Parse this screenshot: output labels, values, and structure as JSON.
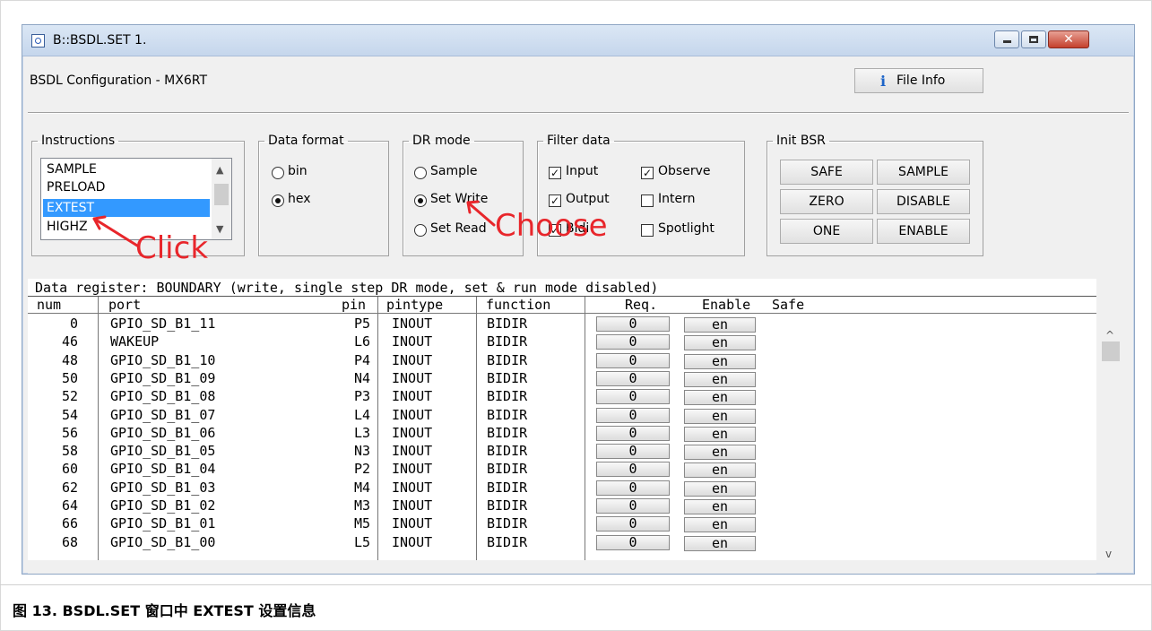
{
  "window": {
    "title": "B::BSDL.SET 1."
  },
  "config": {
    "label": "BSDL Configuration -  MX6RT",
    "file_info_label": "File Info"
  },
  "instructions": {
    "legend": "Instructions",
    "items": [
      "SAMPLE",
      "PRELOAD",
      "EXTEST",
      "HIGHZ"
    ],
    "selected": "EXTEST"
  },
  "data_format": {
    "legend": "Data format",
    "options": [
      "bin",
      "hex"
    ],
    "selected": "hex"
  },
  "dr_mode": {
    "legend": "DR mode",
    "options": [
      "Sample",
      "Set Write",
      "Set Read"
    ],
    "selected": "Set Write"
  },
  "filter_data": {
    "legend": "Filter data",
    "checks": [
      {
        "label": "Input",
        "checked": true
      },
      {
        "label": "Observe",
        "checked": true
      },
      {
        "label": "Output",
        "checked": true
      },
      {
        "label": "Intern",
        "checked": false
      },
      {
        "label": "Bidi",
        "checked": true
      },
      {
        "label": "Spotlight",
        "checked": false
      }
    ]
  },
  "init_bsr": {
    "legend": "Init BSR",
    "buttons": [
      "SAFE",
      "SAMPLE",
      "ZERO",
      "DISABLE",
      "ONE",
      "ENABLE"
    ]
  },
  "annotations": {
    "click": "Click",
    "choose": "Choose"
  },
  "register": {
    "title": "Data register: BOUNDARY (write, single step DR mode, set & run mode disabled)",
    "columns": [
      "num",
      "port",
      "pin",
      "pintype",
      "function",
      "Req.",
      "Enable",
      "Safe"
    ],
    "rows": [
      {
        "num": "0",
        "port": "GPIO_SD_B1_11",
        "pin": "P5",
        "pintype": "INOUT",
        "function": "BIDIR",
        "req": "0",
        "enable": "en"
      },
      {
        "num": "46",
        "port": "WAKEUP",
        "pin": "L6",
        "pintype": "INOUT",
        "function": "BIDIR",
        "req": "0",
        "enable": "en"
      },
      {
        "num": "48",
        "port": "GPIO_SD_B1_10",
        "pin": "P4",
        "pintype": "INOUT",
        "function": "BIDIR",
        "req": "0",
        "enable": "en"
      },
      {
        "num": "50",
        "port": "GPIO_SD_B1_09",
        "pin": "N4",
        "pintype": "INOUT",
        "function": "BIDIR",
        "req": "0",
        "enable": "en"
      },
      {
        "num": "52",
        "port": "GPIO_SD_B1_08",
        "pin": "P3",
        "pintype": "INOUT",
        "function": "BIDIR",
        "req": "0",
        "enable": "en"
      },
      {
        "num": "54",
        "port": "GPIO_SD_B1_07",
        "pin": "L4",
        "pintype": "INOUT",
        "function": "BIDIR",
        "req": "0",
        "enable": "en"
      },
      {
        "num": "56",
        "port": "GPIO_SD_B1_06",
        "pin": "L3",
        "pintype": "INOUT",
        "function": "BIDIR",
        "req": "0",
        "enable": "en"
      },
      {
        "num": "58",
        "port": "GPIO_SD_B1_05",
        "pin": "N3",
        "pintype": "INOUT",
        "function": "BIDIR",
        "req": "0",
        "enable": "en"
      },
      {
        "num": "60",
        "port": "GPIO_SD_B1_04",
        "pin": "P2",
        "pintype": "INOUT",
        "function": "BIDIR",
        "req": "0",
        "enable": "en"
      },
      {
        "num": "62",
        "port": "GPIO_SD_B1_03",
        "pin": "M4",
        "pintype": "INOUT",
        "function": "BIDIR",
        "req": "0",
        "enable": "en"
      },
      {
        "num": "64",
        "port": "GPIO_SD_B1_02",
        "pin": "M3",
        "pintype": "INOUT",
        "function": "BIDIR",
        "req": "0",
        "enable": "en"
      },
      {
        "num": "66",
        "port": "GPIO_SD_B1_01",
        "pin": "M5",
        "pintype": "INOUT",
        "function": "BIDIR",
        "req": "0",
        "enable": "en"
      },
      {
        "num": "68",
        "port": "GPIO_SD_B1_00",
        "pin": "L5",
        "pintype": "INOUT",
        "function": "BIDIR",
        "req": "0",
        "enable": "en"
      }
    ]
  },
  "caption": "图 13. BSDL.SET 窗口中 EXTEST 设置信息",
  "colors": {
    "selection": "#3399ff",
    "annotation": "#e8262b",
    "close_button": "#c4402c"
  }
}
